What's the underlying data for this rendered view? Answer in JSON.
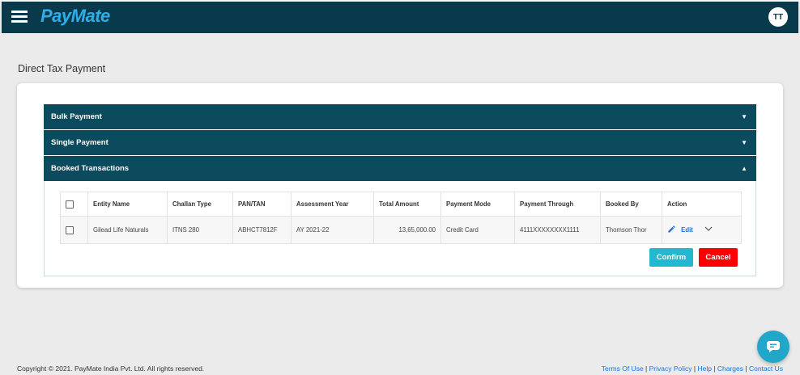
{
  "app": {
    "name": "PayMate",
    "user_initials": "TT"
  },
  "page": {
    "title": "Direct Tax Payment"
  },
  "accordion": [
    {
      "label": "Bulk Payment",
      "state": "collapsed"
    },
    {
      "label": "Single Payment",
      "state": "collapsed"
    },
    {
      "label": "Booked Transactions",
      "state": "expanded"
    }
  ],
  "table": {
    "headers": [
      "Entity Name",
      "Challan Type",
      "PAN/TAN",
      "Assessment Year",
      "Total Amount",
      "Payment Mode",
      "Payment Through",
      "Booked By",
      "Action"
    ],
    "rows": [
      {
        "entity_name": "Gilead Life Naturals",
        "challan_type": "ITNS 280",
        "pan_tan": "ABHCT7812F",
        "assessment_year": "AY 2021-22",
        "total_amount": "13,65,000.00",
        "payment_mode": "Credit Card",
        "payment_through": "4111XXXXXXXX1111",
        "booked_by": "Thomson Thor",
        "action_label": "Edit"
      }
    ]
  },
  "buttons": {
    "confirm": "Confirm",
    "cancel": "Cancel"
  },
  "footer": {
    "copyright": "Copyright © 2021. PayMate India Pvt. Ltd. All rights reserved.",
    "links": [
      "Terms Of Use",
      "Privacy Policy",
      "Help",
      "Charges",
      "Contact Us"
    ]
  },
  "colors": {
    "header": "#083a4b",
    "accordion": "#0c4a5e",
    "logo": "#2eaee8",
    "confirm": "#22b8cf",
    "cancel": "#ff0000",
    "link": "#1a73e8"
  },
  "icons": [
    "hamburger-menu-icon",
    "collapse-arrow-icon",
    "expand-arrow-icon",
    "pencil-icon",
    "chevron-down-icon",
    "chat-icon"
  ]
}
